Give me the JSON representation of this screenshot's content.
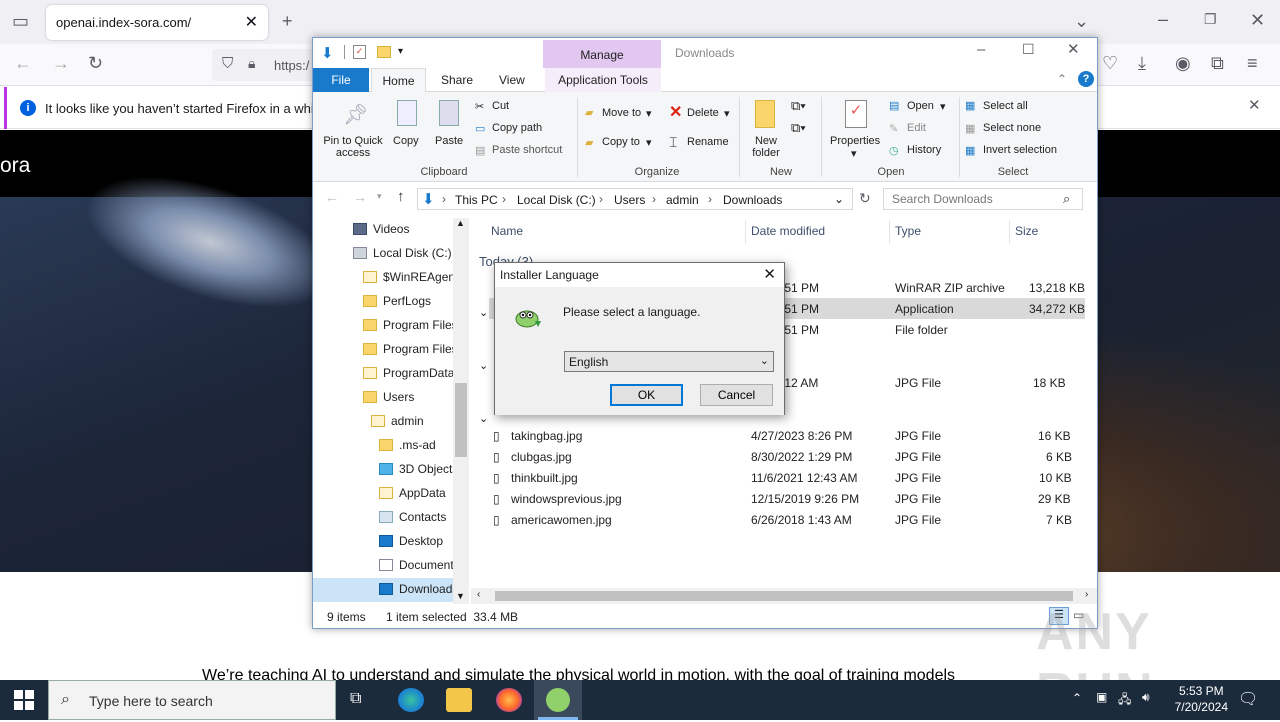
{
  "browser": {
    "tab_title": "openai.index-sora.com/",
    "url_partial": "https:/",
    "notice": "It looks like you haven’t started Firefox in a while. D"
  },
  "page": {
    "brand_partial": "ora",
    "tagline": "We’re teaching AI to understand and simulate the physical world in motion, with the goal of training models"
  },
  "explorer": {
    "title": "Downloads",
    "manage_tab": "Manage",
    "tabs": [
      "File",
      "Home",
      "Share",
      "View",
      "Application Tools"
    ],
    "clipboard": {
      "pin": "Pin to Quick access",
      "copy": "Copy",
      "paste": "Paste",
      "cut": "Cut",
      "copy_path": "Copy path",
      "paste_shortcut": "Paste shortcut",
      "label": "Clipboard"
    },
    "organize": {
      "move_to": "Move to",
      "copy_to": "Copy to",
      "delete": "Delete",
      "rename": "Rename",
      "label": "Organize"
    },
    "new": {
      "new_folder": "New folder",
      "label": "New"
    },
    "open": {
      "properties": "Properties",
      "open": "Open",
      "edit": "Edit",
      "history": "History",
      "label": "Open"
    },
    "select": {
      "select_all": "Select all",
      "select_none": "Select none",
      "invert": "Invert selection",
      "label": "Select"
    },
    "breadcrumb": [
      "This PC",
      "Local Disk (C:)",
      "Users",
      "admin",
      "Downloads"
    ],
    "search_placeholder": "Search Downloads",
    "nav": [
      "Videos",
      "Local Disk (C:)",
      "$WinREAgent",
      "PerfLogs",
      "Program Files",
      "Program Files",
      "ProgramData",
      "Users",
      "admin",
      ".ms-ad",
      "3D Objects",
      "AppData",
      "Contacts",
      "Desktop",
      "Documents",
      "Downloads"
    ],
    "columns": {
      "name": "Name",
      "date": "Date modified",
      "type": "Type",
      "size": "Size"
    },
    "group_today": "Today (3)",
    "rows": [
      {
        "date": "024 5:51 PM",
        "type": "WinRAR ZIP archive",
        "size": "13,218 KB"
      },
      {
        "date": "024 5:51 PM",
        "type": "Application",
        "size": "34,272 KB"
      },
      {
        "date": "024 5:51 PM",
        "type": "File folder",
        "size": ""
      },
      {
        "date": "024 9:12 AM",
        "type": "JPG File",
        "size": "18 KB"
      }
    ],
    "files": [
      {
        "name": "takingbag.jpg",
        "date": "4/27/2023 8:26 PM",
        "type": "JPG File",
        "size": "16 KB"
      },
      {
        "name": "clubgas.jpg",
        "date": "8/30/2022 1:29 PM",
        "type": "JPG File",
        "size": "6 KB"
      },
      {
        "name": "thinkbuilt.jpg",
        "date": "11/6/2021 12:43 AM",
        "type": "JPG File",
        "size": "10 KB"
      },
      {
        "name": "windowsprevious.jpg",
        "date": "12/15/2019 9:26 PM",
        "type": "JPG File",
        "size": "29 KB"
      },
      {
        "name": "americawomen.jpg",
        "date": "6/26/2018 1:43 AM",
        "type": "JPG File",
        "size": "7 KB"
      }
    ],
    "status_items": "9 items",
    "status_selected": "1 item selected  33.4 MB"
  },
  "dialog": {
    "title": "Installer Language",
    "message": "Please select a language.",
    "selected_language": "English",
    "ok": "OK",
    "cancel": "Cancel"
  },
  "taskbar": {
    "search_placeholder": "Type here to search",
    "time": "5:53 PM",
    "date": "7/20/2024"
  },
  "watermark": "ANY RUN"
}
